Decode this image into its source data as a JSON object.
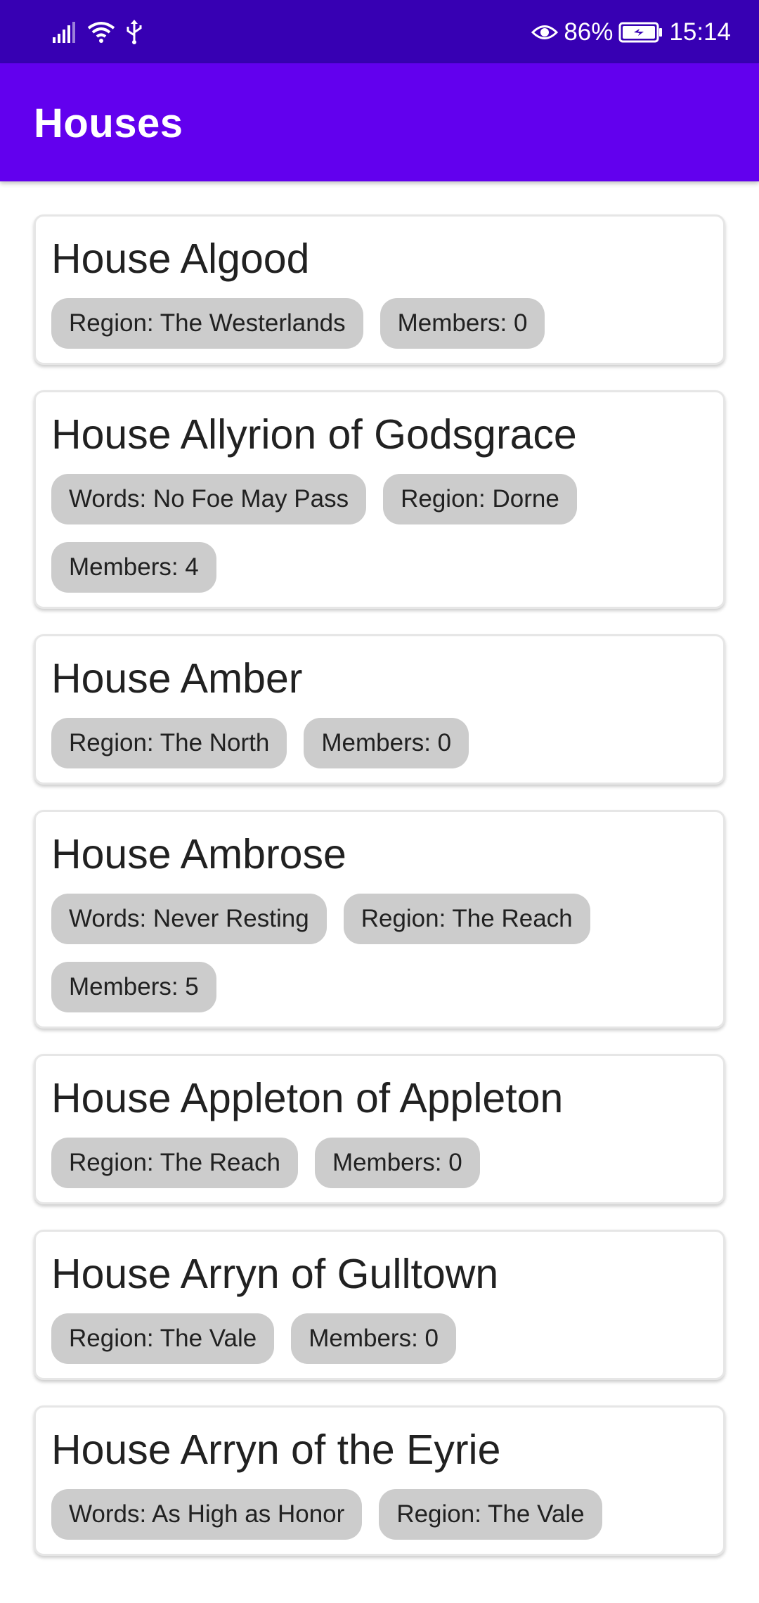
{
  "status_bar": {
    "icons_left": [
      "signal-icon",
      "wifi-icon",
      "usb-icon"
    ],
    "icons_right": [
      "eye-comfort-icon",
      "battery-icon"
    ],
    "battery_percent": "86%",
    "time": "15:14",
    "bg_color": "#3700b3"
  },
  "app_bar": {
    "title": "Houses",
    "bg_color": "#6200ee"
  },
  "houses": [
    {
      "name": "House Algood",
      "chips": [
        "Region: The Westerlands",
        "Members: 0"
      ]
    },
    {
      "name": "House Allyrion of Godsgrace",
      "chips": [
        "Words: No Foe May Pass",
        "Region: Dorne",
        "Members: 4"
      ]
    },
    {
      "name": "House Amber",
      "chips": [
        "Region: The North",
        "Members: 0"
      ]
    },
    {
      "name": "House Ambrose",
      "chips": [
        "Words: Never Resting",
        "Region: The Reach",
        "Members: 5"
      ]
    },
    {
      "name": "House Appleton of Appleton",
      "chips": [
        "Region: The Reach",
        "Members: 0"
      ]
    },
    {
      "name": "House Arryn of Gulltown",
      "chips": [
        "Region: The Vale",
        "Members: 0"
      ]
    },
    {
      "name": "House Arryn of the Eyrie",
      "chips": [
        "Words: As High as Honor",
        "Region: The Vale"
      ]
    }
  ],
  "chip_color": "#cccccc"
}
